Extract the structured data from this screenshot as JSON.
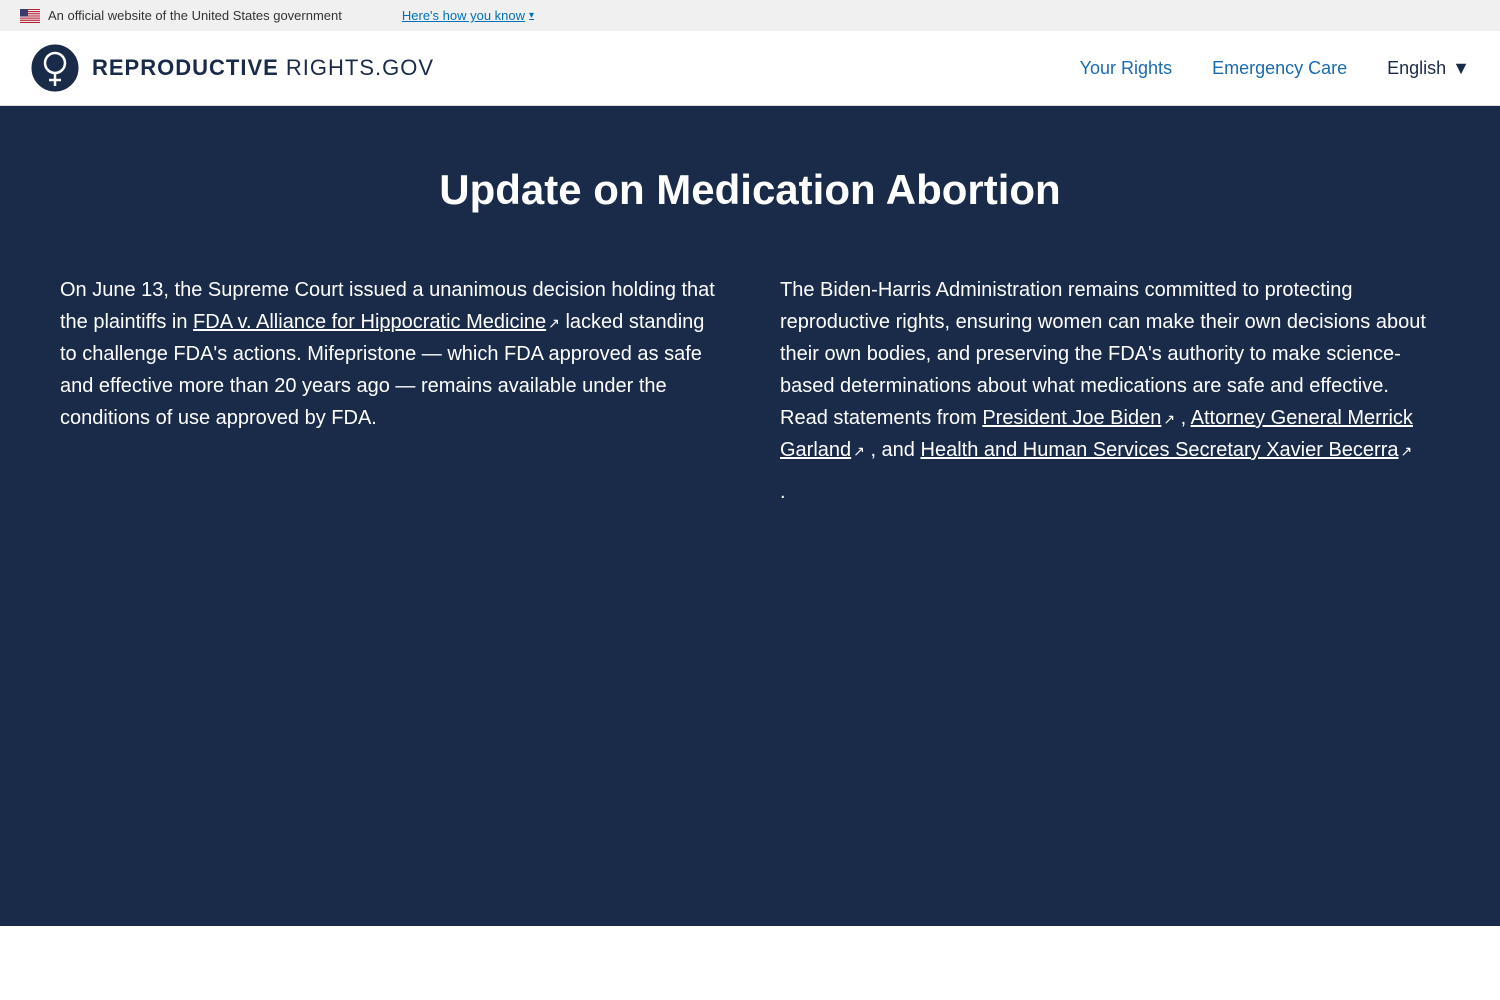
{
  "govBanner": {
    "officialText": "An official website of the United States government",
    "linkText": "Here's how you know"
  },
  "header": {
    "logoText": "REPRODUCTIVE",
    "logoRights": " RIGHTS",
    "logoDotGov": ".GOV",
    "navLinks": [
      {
        "id": "your-rights",
        "label": "Your Rights"
      },
      {
        "id": "emergency-care",
        "label": "Emergency Care"
      }
    ],
    "language": {
      "label": "English",
      "dropdownArrow": "▼"
    }
  },
  "hero": {
    "title": "Update on Medication Abortion",
    "leftColumn": {
      "text1": "On June 13, the Supreme Court issued a unanimous decision holding that the plaintiffs in ",
      "link1Text": "FDA v. Alliance for Hippocratic Medicine",
      "text2": "  lacked standing to challenge FDA's actions. Mifepristone — which FDA approved as safe and effective more than 20 years ago — remains available under the conditions of use approved by FDA."
    },
    "rightColumn": {
      "text1": "The Biden-Harris Administration remains committed to protecting reproductive rights, ensuring women can make their own decisions about their own bodies, and preserving the FDA's authority to make science-based determinations about what medications are safe and effective. Read statements from ",
      "link1Text": "President Joe Biden",
      "text2": " , ",
      "link2Text": "Attorney General Merrick Garland",
      "text3": " , and ",
      "link3Text": "Health and Human Services Secretary Xavier Becerra",
      "period": "."
    }
  }
}
